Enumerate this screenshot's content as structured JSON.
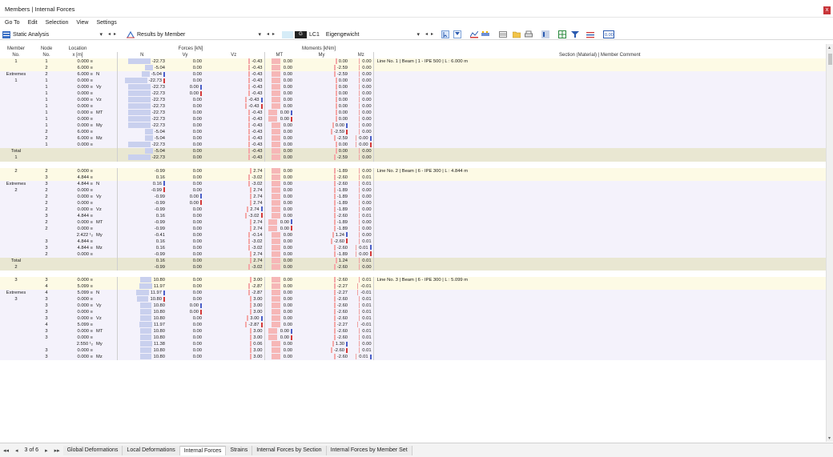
{
  "window": {
    "title": "Members | Internal Forces",
    "close": "x"
  },
  "menu": [
    "Go To",
    "Edit",
    "Selection",
    "View",
    "Settings"
  ],
  "toolbar": {
    "analysis": "Static Analysis",
    "results": "Results by Member",
    "lc_badge": "G",
    "lc_id": "LC1",
    "lc_name": "Eigengewicht"
  },
  "headers": {
    "member_no": [
      "Member",
      "No."
    ],
    "node_no": [
      "Node",
      "No."
    ],
    "location": [
      "Location",
      "x [m]"
    ],
    "forces_group": "Forces [kN]",
    "moments_group": "Moments [kNm]",
    "n": "N",
    "vy": "Vy",
    "vz": "Vz",
    "mt": "MT",
    "my": "My",
    "mz": "Mz",
    "comment": "Section (Material) | Member Comment"
  },
  "rows": [
    {
      "t": "y",
      "mem": "1",
      "node": "1",
      "loc": "0.000 ≡",
      "tag": "",
      "n": "-22.73",
      "vy": "0.00",
      "vz": "-0.43",
      "mt": "0.00",
      "my": "0.00",
      "mz": "0.00",
      "cmt": "Line No. 1 | Beam | 1 - IPE 500 | L : 6.000 m",
      "nb": 28
    },
    {
      "t": "y",
      "mem": "",
      "node": "2",
      "loc": "6.000 ≡",
      "tag": "",
      "n": "-5.04",
      "vy": "0.00",
      "vz": "-0.43",
      "mt": "0.00",
      "my": "-2.59",
      "mz": "0.00",
      "cmt": "",
      "nb": 10
    },
    {
      "t": "p",
      "mem": "Extremes",
      "node": "2",
      "loc": "6.000 ≡",
      "tag": "N",
      "n": "-5.04",
      "vy": "0.00",
      "vz": "-0.43",
      "mt": "0.00",
      "my": "-2.59",
      "mz": "0.00",
      "cmt": "",
      "nb": 10,
      "mn": "b"
    },
    {
      "t": "p",
      "mem": "1",
      "node": "1",
      "loc": "0.000 ≡",
      "tag": "",
      "n": "-22.73",
      "vy": "0.00",
      "vz": "-0.43",
      "mt": "0.00",
      "my": "0.00",
      "mz": "0.00",
      "cmt": "",
      "nb": 28,
      "mn": "r"
    },
    {
      "t": "p",
      "mem": "",
      "node": "1",
      "loc": "0.000 ≡",
      "tag": "Vy",
      "n": "-22.73",
      "vy": "0.00",
      "vz": "-0.43",
      "mt": "0.00",
      "my": "0.00",
      "mz": "0.00",
      "cmt": "",
      "nb": 28,
      "mvy": "b"
    },
    {
      "t": "p",
      "mem": "",
      "node": "1",
      "loc": "0.000 ≡",
      "tag": "",
      "n": "-22.73",
      "vy": "0.00",
      "vz": "-0.43",
      "mt": "0.00",
      "my": "0.00",
      "mz": "0.00",
      "cmt": "",
      "nb": 28,
      "mvy": "r"
    },
    {
      "t": "p",
      "mem": "",
      "node": "1",
      "loc": "0.000 ≡",
      "tag": "Vz",
      "n": "-22.73",
      "vy": "0.00",
      "vz": "-0.43",
      "mt": "0.00",
      "my": "0.00",
      "mz": "0.00",
      "cmt": "",
      "nb": 28,
      "mvz": "b"
    },
    {
      "t": "p",
      "mem": "",
      "node": "1",
      "loc": "0.000 ≡",
      "tag": "",
      "n": "-22.73",
      "vy": "0.00",
      "vz": "-0.43",
      "mt": "0.00",
      "my": "0.00",
      "mz": "0.00",
      "cmt": "",
      "nb": 28,
      "mvz": "r"
    },
    {
      "t": "p",
      "mem": "",
      "node": "1",
      "loc": "0.000 ≡",
      "tag": "MT",
      "n": "-22.73",
      "vy": "0.00",
      "vz": "-0.43",
      "mt": "0.00",
      "my": "0.00",
      "mz": "0.00",
      "cmt": "",
      "nb": 28,
      "mmt": "b"
    },
    {
      "t": "p",
      "mem": "",
      "node": "1",
      "loc": "0.000 ≡",
      "tag": "",
      "n": "-22.73",
      "vy": "0.00",
      "vz": "-0.43",
      "mt": "0.00",
      "my": "0.00",
      "mz": "0.00",
      "cmt": "",
      "nb": 28,
      "mmt": "r"
    },
    {
      "t": "p",
      "mem": "",
      "node": "1",
      "loc": "0.000 ≡",
      "tag": "My",
      "n": "-22.73",
      "vy": "0.00",
      "vz": "-0.43",
      "mt": "0.00",
      "my": "0.00",
      "mz": "0.00",
      "cmt": "",
      "nb": 28,
      "mmy": "b"
    },
    {
      "t": "p",
      "mem": "",
      "node": "2",
      "loc": "6.000 ≡",
      "tag": "",
      "n": "-5.04",
      "vy": "0.00",
      "vz": "-0.43",
      "mt": "0.00",
      "my": "-2.59",
      "mz": "0.00",
      "cmt": "",
      "nb": 10,
      "mmy": "r"
    },
    {
      "t": "p",
      "mem": "",
      "node": "2",
      "loc": "6.000 ≡",
      "tag": "Mz",
      "n": "-5.04",
      "vy": "0.00",
      "vz": "-0.43",
      "mt": "0.00",
      "my": "-2.59",
      "mz": "0.00",
      "cmt": "",
      "nb": 10,
      "mmz": "b"
    },
    {
      "t": "p",
      "mem": "",
      "node": "1",
      "loc": "0.000 ≡",
      "tag": "",
      "n": "-22.73",
      "vy": "0.00",
      "vz": "-0.43",
      "mt": "0.00",
      "my": "0.00",
      "mz": "0.00",
      "cmt": "",
      "nb": 28,
      "mmz": "r"
    },
    {
      "t": "t",
      "mem": "Total",
      "node": "",
      "loc": "",
      "tag": "",
      "n": "-5.04",
      "vy": "0.00",
      "vz": "-0.43",
      "mt": "0.00",
      "my": "0.00",
      "mz": "0.00",
      "cmt": "",
      "nb": 10
    },
    {
      "t": "t",
      "mem": "1",
      "node": "",
      "loc": "",
      "tag": "",
      "n": "-22.73",
      "vy": "0.00",
      "vz": "-0.43",
      "mt": "0.00",
      "my": "-2.59",
      "mz": "0.00",
      "cmt": "",
      "nb": 28
    },
    {
      "t": "g"
    },
    {
      "t": "y",
      "mem": "2",
      "node": "2",
      "loc": "0.000 ≡",
      "tag": "",
      "n": "-0.99",
      "vy": "0.00",
      "vz": "2.74",
      "mt": "0.00",
      "my": "-1.89",
      "mz": "0.00",
      "cmt": "Line No. 2 | Beam | 6 - IPE 300 | L : 4.844 m",
      "nb": 0
    },
    {
      "t": "y",
      "mem": "",
      "node": "3",
      "loc": "4.844 ≡",
      "tag": "",
      "n": "0.16",
      "vy": "0.00",
      "vz": "-3.02",
      "mt": "0.00",
      "my": "-2.60",
      "mz": "0.01",
      "cmt": "",
      "nb": 0
    },
    {
      "t": "p",
      "mem": "Extremes",
      "node": "3",
      "loc": "4.844 ≡",
      "tag": "N",
      "n": "0.16",
      "vy": "0.00",
      "vz": "-3.02",
      "mt": "0.00",
      "my": "-2.60",
      "mz": "0.01",
      "cmt": "",
      "nb": 0,
      "mn": "b"
    },
    {
      "t": "p",
      "mem": "2",
      "node": "2",
      "loc": "0.000 ≡",
      "tag": "",
      "n": "-0.99",
      "vy": "0.00",
      "vz": "2.74",
      "mt": "0.00",
      "my": "-1.89",
      "mz": "0.00",
      "cmt": "",
      "nb": 0,
      "mn": "r"
    },
    {
      "t": "p",
      "mem": "",
      "node": "2",
      "loc": "0.000 ≡",
      "tag": "Vy",
      "n": "-0.99",
      "vy": "0.00",
      "vz": "2.74",
      "mt": "0.00",
      "my": "-1.89",
      "mz": "0.00",
      "cmt": "",
      "nb": 0,
      "mvy": "b"
    },
    {
      "t": "p",
      "mem": "",
      "node": "2",
      "loc": "0.000 ≡",
      "tag": "",
      "n": "-0.99",
      "vy": "0.00",
      "vz": "2.74",
      "mt": "0.00",
      "my": "-1.89",
      "mz": "0.00",
      "cmt": "",
      "nb": 0,
      "mvy": "r"
    },
    {
      "t": "p",
      "mem": "",
      "node": "2",
      "loc": "0.000 ≡",
      "tag": "Vz",
      "n": "-0.99",
      "vy": "0.00",
      "vz": "2.74",
      "mt": "0.00",
      "my": "-1.89",
      "mz": "0.00",
      "cmt": "",
      "nb": 0,
      "mvz": "b"
    },
    {
      "t": "p",
      "mem": "",
      "node": "3",
      "loc": "4.844 ≡",
      "tag": "",
      "n": "0.16",
      "vy": "0.00",
      "vz": "-3.02",
      "mt": "0.00",
      "my": "-2.60",
      "mz": "0.01",
      "cmt": "",
      "nb": 0,
      "mvz": "r"
    },
    {
      "t": "p",
      "mem": "",
      "node": "2",
      "loc": "0.000 ≡",
      "tag": "MT",
      "n": "-0.99",
      "vy": "0.00",
      "vz": "2.74",
      "mt": "0.00",
      "my": "-1.89",
      "mz": "0.00",
      "cmt": "",
      "nb": 0,
      "mmt": "b"
    },
    {
      "t": "p",
      "mem": "",
      "node": "2",
      "loc": "0.000 ≡",
      "tag": "",
      "n": "-0.99",
      "vy": "0.00",
      "vz": "2.74",
      "mt": "0.00",
      "my": "-1.89",
      "mz": "0.00",
      "cmt": "",
      "nb": 0,
      "mmt": "r"
    },
    {
      "t": "p",
      "mem": "",
      "node": "",
      "loc": "2.422 ¹₂",
      "tag": "My",
      "n": "-0.41",
      "vy": "0.00",
      "vz": "-0.14",
      "mt": "0.00",
      "my": "1.24",
      "mz": "0.00",
      "cmt": "",
      "nb": 0,
      "mmy": "b"
    },
    {
      "t": "p",
      "mem": "",
      "node": "3",
      "loc": "4.844 ≡",
      "tag": "",
      "n": "0.16",
      "vy": "0.00",
      "vz": "-3.02",
      "mt": "0.00",
      "my": "-2.60",
      "mz": "0.01",
      "cmt": "",
      "nb": 0,
      "mmy": "r"
    },
    {
      "t": "p",
      "mem": "",
      "node": "3",
      "loc": "4.844 ≡",
      "tag": "Mz",
      "n": "0.16",
      "vy": "0.00",
      "vz": "-3.02",
      "mt": "0.00",
      "my": "-2.60",
      "mz": "0.01",
      "cmt": "",
      "nb": 0,
      "mmz": "b"
    },
    {
      "t": "p",
      "mem": "",
      "node": "2",
      "loc": "0.000 ≡",
      "tag": "",
      "n": "-0.99",
      "vy": "0.00",
      "vz": "2.74",
      "mt": "0.00",
      "my": "-1.89",
      "mz": "0.00",
      "cmt": "",
      "nb": 0,
      "mmz": "r"
    },
    {
      "t": "t",
      "mem": "Total",
      "node": "",
      "loc": "",
      "tag": "",
      "n": "0.16",
      "vy": "0.00",
      "vz": "2.74",
      "mt": "0.00",
      "my": "1.24",
      "mz": "0.01",
      "cmt": "",
      "nb": 0
    },
    {
      "t": "t",
      "mem": "2",
      "node": "",
      "loc": "",
      "tag": "",
      "n": "-0.99",
      "vy": "0.00",
      "vz": "-3.02",
      "mt": "0.00",
      "my": "-2.60",
      "mz": "0.00",
      "cmt": "",
      "nb": 0
    },
    {
      "t": "g"
    },
    {
      "t": "y",
      "mem": "3",
      "node": "3",
      "loc": "0.000 ≡",
      "tag": "",
      "n": "10.80",
      "vy": "0.00",
      "vz": "3.00",
      "mt": "0.00",
      "my": "-2.60",
      "mz": "0.01",
      "cmt": "Line No. 3 | Beam | 6 - IPE 300 | L : 5.099 m",
      "nb": 14
    },
    {
      "t": "y",
      "mem": "",
      "node": "4",
      "loc": "5.099 ≡",
      "tag": "",
      "n": "11.97",
      "vy": "0.00",
      "vz": "-2.87",
      "mt": "0.00",
      "my": "-2.27",
      "mz": "-0.01",
      "cmt": "",
      "nb": 16
    },
    {
      "t": "p",
      "mem": "Extremes",
      "node": "4",
      "loc": "5.099 ≡",
      "tag": "N",
      "n": "11.97",
      "vy": "0.00",
      "vz": "-2.87",
      "mt": "0.00",
      "my": "-2.27",
      "mz": "-0.01",
      "cmt": "",
      "nb": 16,
      "mn": "b"
    },
    {
      "t": "p",
      "mem": "3",
      "node": "3",
      "loc": "0.000 ≡",
      "tag": "",
      "n": "10.80",
      "vy": "0.00",
      "vz": "3.00",
      "mt": "0.00",
      "my": "-2.60",
      "mz": "0.01",
      "cmt": "",
      "nb": 14,
      "mn": "r"
    },
    {
      "t": "p",
      "mem": "",
      "node": "3",
      "loc": "0.000 ≡",
      "tag": "Vy",
      "n": "10.80",
      "vy": "0.00",
      "vz": "3.00",
      "mt": "0.00",
      "my": "-2.60",
      "mz": "0.01",
      "cmt": "",
      "nb": 14,
      "mvy": "b"
    },
    {
      "t": "p",
      "mem": "",
      "node": "3",
      "loc": "0.000 ≡",
      "tag": "",
      "n": "10.80",
      "vy": "0.00",
      "vz": "3.00",
      "mt": "0.00",
      "my": "-2.60",
      "mz": "0.01",
      "cmt": "",
      "nb": 14,
      "mvy": "r"
    },
    {
      "t": "p",
      "mem": "",
      "node": "3",
      "loc": "0.000 ≡",
      "tag": "Vz",
      "n": "10.80",
      "vy": "0.00",
      "vz": "3.00",
      "mt": "0.00",
      "my": "-2.60",
      "mz": "0.01",
      "cmt": "",
      "nb": 14,
      "mvz": "b"
    },
    {
      "t": "p",
      "mem": "",
      "node": "4",
      "loc": "5.099 ≡",
      "tag": "",
      "n": "11.97",
      "vy": "0.00",
      "vz": "-2.87",
      "mt": "0.00",
      "my": "-2.27",
      "mz": "-0.01",
      "cmt": "",
      "nb": 16,
      "mvz": "r"
    },
    {
      "t": "p",
      "mem": "",
      "node": "3",
      "loc": "0.000 ≡",
      "tag": "MT",
      "n": "10.80",
      "vy": "0.00",
      "vz": "3.00",
      "mt": "0.00",
      "my": "-2.60",
      "mz": "0.01",
      "cmt": "",
      "nb": 14,
      "mmt": "b"
    },
    {
      "t": "p",
      "mem": "",
      "node": "3",
      "loc": "0.000 ≡",
      "tag": "",
      "n": "10.80",
      "vy": "0.00",
      "vz": "3.00",
      "mt": "0.00",
      "my": "-2.60",
      "mz": "0.01",
      "cmt": "",
      "nb": 14,
      "mmt": "r"
    },
    {
      "t": "p",
      "mem": "",
      "node": "",
      "loc": "2.550 ¹₂",
      "tag": "My",
      "n": "11.38",
      "vy": "0.00",
      "vz": "0.06",
      "mt": "0.00",
      "my": "1.30",
      "mz": "0.00",
      "cmt": "",
      "nb": 15,
      "mmy": "b"
    },
    {
      "t": "p",
      "mem": "",
      "node": "3",
      "loc": "0.000 ≡",
      "tag": "",
      "n": "10.80",
      "vy": "0.00",
      "vz": "3.00",
      "mt": "0.00",
      "my": "-2.60",
      "mz": "0.01",
      "cmt": "",
      "nb": 14,
      "mmy": "r"
    },
    {
      "t": "p",
      "mem": "",
      "node": "3",
      "loc": "0.000 ≡",
      "tag": "Mz",
      "n": "10.80",
      "vy": "0.00",
      "vz": "3.00",
      "mt": "0.00",
      "my": "-2.60",
      "mz": "0.01",
      "cmt": "",
      "nb": 14,
      "mmz": "b"
    }
  ],
  "tabs": {
    "page": "3 of 6",
    "items": [
      "Global Deformations",
      "Local Deformations",
      "Internal Forces",
      "Strains",
      "Internal Forces by Section",
      "Internal Forces by Member Set"
    ],
    "active": 2
  },
  "colors": {
    "yellow_row": "#fdfae5",
    "purple_row": "#f4f2fb",
    "total_row": "#e9e7d2",
    "marker_blue": "#4a5fc8",
    "marker_red": "#d53a3a"
  }
}
